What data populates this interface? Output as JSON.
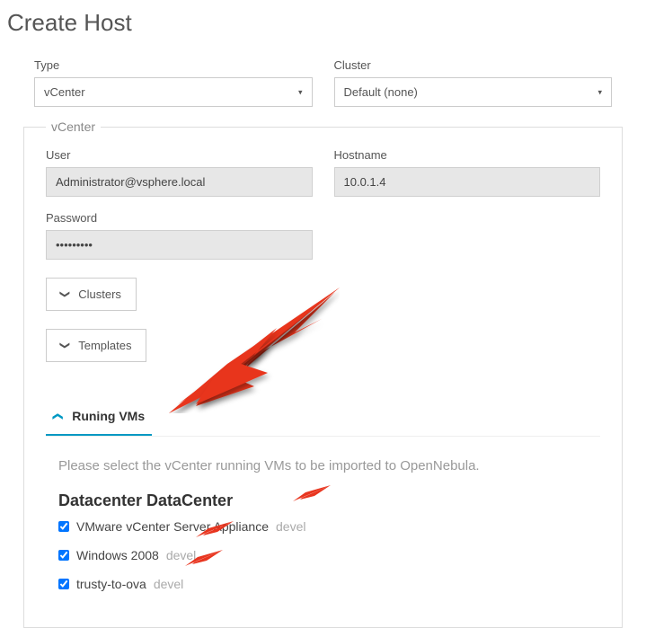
{
  "page": {
    "title": "Create Host"
  },
  "fields": {
    "type": {
      "label": "Type",
      "value": "vCenter"
    },
    "cluster": {
      "label": "Cluster",
      "value": "Default (none)"
    }
  },
  "vcenter": {
    "legend": "vCenter",
    "user": {
      "label": "User",
      "value": "Administrator@vsphere.local"
    },
    "hostname": {
      "label": "Hostname",
      "value": "10.0.1.4"
    },
    "password": {
      "label": "Password",
      "value": "•••••••••"
    },
    "buttons": {
      "clusters": "Clusters",
      "templates": "Templates"
    },
    "tab": {
      "label": "Runing VMs"
    },
    "instructions": "Please select the vCenter running VMs to be imported to OpenNebula.",
    "datacenter": "Datacenter DataCenter",
    "vms": [
      {
        "name": "VMware vCenter Server Appliance",
        "tag": "devel",
        "checked": true
      },
      {
        "name": "Windows 2008",
        "tag": "devel",
        "checked": true
      },
      {
        "name": "trusty-to-ova",
        "tag": "devel",
        "checked": true
      }
    ]
  }
}
